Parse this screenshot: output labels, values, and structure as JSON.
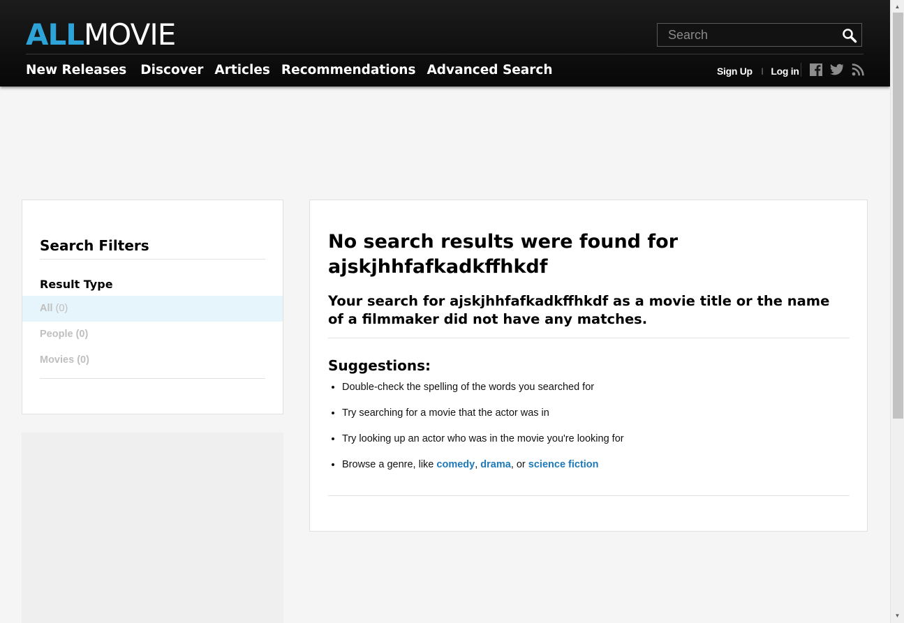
{
  "header": {
    "logo_all": "ALL",
    "logo_movie": "MOVIE",
    "search_placeholder": "Search",
    "nav": [
      "New Releases",
      "Discover",
      "Articles",
      "Recommendations",
      "Advanced Search"
    ],
    "sign_up": "Sign Up",
    "separator": "|",
    "log_in": "Log in",
    "social_icons": [
      "facebook-icon",
      "twitter-icon",
      "rss-icon"
    ]
  },
  "filters": {
    "title": "Search Filters",
    "result_type_heading": "Result Type",
    "items": [
      {
        "label": "All",
        "count": "(0)"
      },
      {
        "label": "People",
        "count": "(0)"
      },
      {
        "label": "Movies",
        "count": "(0)"
      }
    ]
  },
  "main": {
    "heading": "No search results were found for ajskjhhfafkadkffhkdf",
    "lead": "Your search for ajskjhhfafkadkffhkdf as a movie title or the name of a filmmaker did not have any matches.",
    "suggestions_heading": "Suggestions:",
    "tips": [
      "Double-check the spelling of the words you searched for",
      "Try searching for a movie that the actor was in",
      "Try looking up an actor who was in the movie you're looking for"
    ],
    "browse_prefix": "Browse a genre, like ",
    "genres": [
      "comedy",
      "drama",
      "science fiction"
    ],
    "comma": ", ",
    "or_text": ", or "
  },
  "colors": {
    "brand_blue": "#2ea3d8",
    "link_blue": "#1d79b8",
    "header_bg": "#0d0d0d",
    "active_filter_bg": "#e6f4fb"
  }
}
